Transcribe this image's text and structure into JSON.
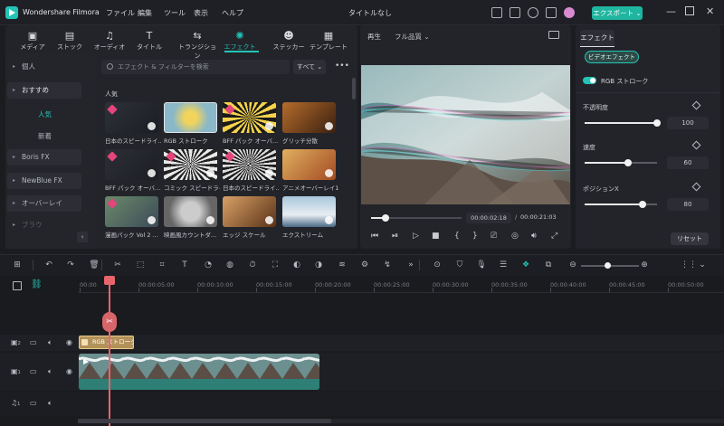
{
  "app": {
    "name": "Wondershare Filmora",
    "title": "タイトルなし"
  },
  "menu": [
    "ファイル",
    "編集",
    "ツール",
    "表示",
    "ヘルプ"
  ],
  "export_label": "エクスポート ⌄",
  "tabs": [
    {
      "label": "メディア",
      "icon": "media-icon"
    },
    {
      "label": "ストック",
      "icon": "stock-icon"
    },
    {
      "label": "オーディオ",
      "icon": "music-icon"
    },
    {
      "label": "タイトル",
      "icon": "title-icon"
    },
    {
      "label": "トランジション",
      "icon": "transition-icon"
    },
    {
      "label": "エフェクト",
      "icon": "effects-icon"
    },
    {
      "label": "ステッカー",
      "icon": "sticker-icon"
    },
    {
      "label": "テンプレート",
      "icon": "template-icon"
    }
  ],
  "sidebar": {
    "items": [
      "個人",
      "おすすめ",
      "Boris FX",
      "NewBlue FX",
      "オーバーレイ",
      "ブラウ"
    ],
    "sub": [
      "人気",
      "新着"
    ]
  },
  "search": {
    "placeholder": "エフェクト & フィルターを検索",
    "filter": "すべて ⌄"
  },
  "section": "人気",
  "thumbs": [
    {
      "label": "日本のスピードライ..."
    },
    {
      "label": "RGB ストローク"
    },
    {
      "label": "BFF パック オーバ..."
    },
    {
      "label": "グリッチ分散"
    },
    {
      "label": "BFF パック オーバ..."
    },
    {
      "label": "コミック スピードライ..."
    },
    {
      "label": "日本のスピードライ..."
    },
    {
      "label": "アニメオーバーレイ1"
    },
    {
      "label": "漫画パック Vol 2 ..."
    },
    {
      "label": "映画風カウントダ..."
    },
    {
      "label": "エッジ スケール"
    },
    {
      "label": "エクストリーム"
    }
  ],
  "preview": {
    "play_label": "再生",
    "quality": "フル品質 ⌄",
    "current": "00:00:02:18",
    "total": "00:00:21:03",
    "progress": 0.08
  },
  "right": {
    "tab": "エフェクト",
    "chip": "ビデオエフェクト",
    "effect_name": "RGB ストローク",
    "params": [
      {
        "label": "不透明度",
        "value": "100",
        "level": 1.0
      },
      {
        "label": "速度",
        "value": "60",
        "level": 0.6
      },
      {
        "label": "ポジションX",
        "value": "80",
        "level": 0.8
      }
    ],
    "reset": "リセット"
  },
  "ruler": [
    "00:00",
    "00:00:05:00",
    "00:00:10:00",
    "00:00:15:00",
    "00:00:20:00",
    "00:00:25:00",
    "00:00:30:00",
    "00:00:35:00",
    "00:00:40:00",
    "00:00:45:00",
    "00:00:50:00"
  ],
  "tracks": {
    "effect_clip": "RGB ストローク",
    "video_num2": "2",
    "video_num1": "1",
    "audio_num1": "1"
  }
}
